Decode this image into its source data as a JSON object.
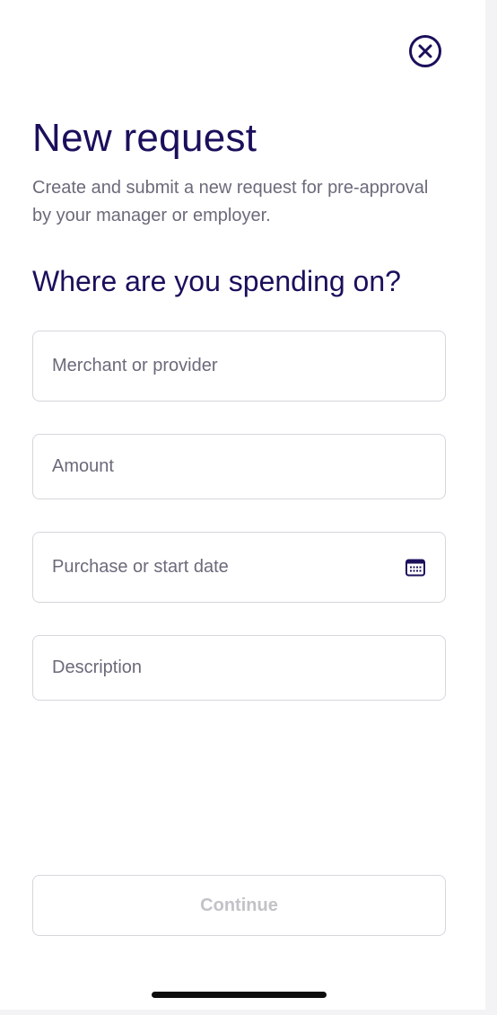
{
  "header": {
    "title": "New request",
    "subtitle": "Create and submit a new request for pre-approval by your manager or employer.",
    "close_icon": "close-circle-icon"
  },
  "form": {
    "heading": "Where are you spending on?",
    "merchant": {
      "placeholder": "Merchant or provider",
      "value": ""
    },
    "amount": {
      "placeholder": "Amount",
      "value": ""
    },
    "date": {
      "placeholder": "Purchase or start date",
      "value": "",
      "icon": "calendar-icon"
    },
    "description": {
      "placeholder": "Description",
      "value": ""
    }
  },
  "actions": {
    "continue_label": "Continue",
    "continue_enabled": false
  },
  "colors": {
    "primary_text": "#1b0f5c",
    "secondary_text": "#6b6a7a",
    "border": "#d6d6dc",
    "disabled_text": "#c2c2c8"
  }
}
